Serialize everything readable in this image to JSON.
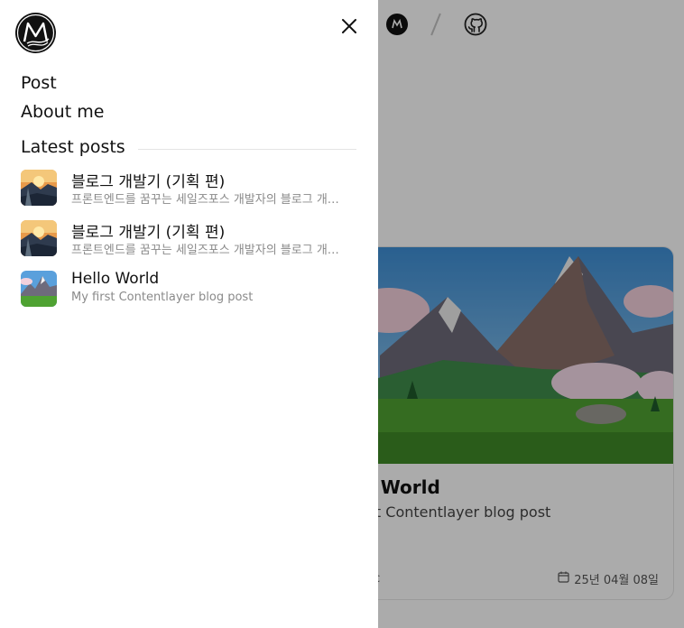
{
  "drawer": {
    "nav": [
      {
        "label": "Post"
      },
      {
        "label": "About me"
      }
    ],
    "section_title": "Latest posts",
    "posts": [
      {
        "title": "블로그 개발기 (기획 편)",
        "description": "프론트엔드를 꿈꾸는 세일즈포스 개발자의 블로그 개발기 (기획 편)"
      },
      {
        "title": "블로그 개발기 (기획 편)",
        "description": "프론트엔드를 꿈꾸는 세일즈포스 개발자의 블로그 개발기 (기획 편)"
      },
      {
        "title": "Hello World",
        "description": "My first Contentlayer blog post"
      }
    ]
  },
  "background": {
    "card": {
      "title": "o World",
      "description": "rst Contentlayer blog post",
      "tag": "etc",
      "date": "25년 04월 08일"
    }
  },
  "icons": {
    "logo": "m-logo-icon",
    "close": "close-icon",
    "github": "github-icon",
    "calendar": "calendar-icon"
  },
  "colors": {
    "overlay": "#000000",
    "drawer_bg": "#ffffff",
    "muted_text": "#8a8a8a"
  }
}
